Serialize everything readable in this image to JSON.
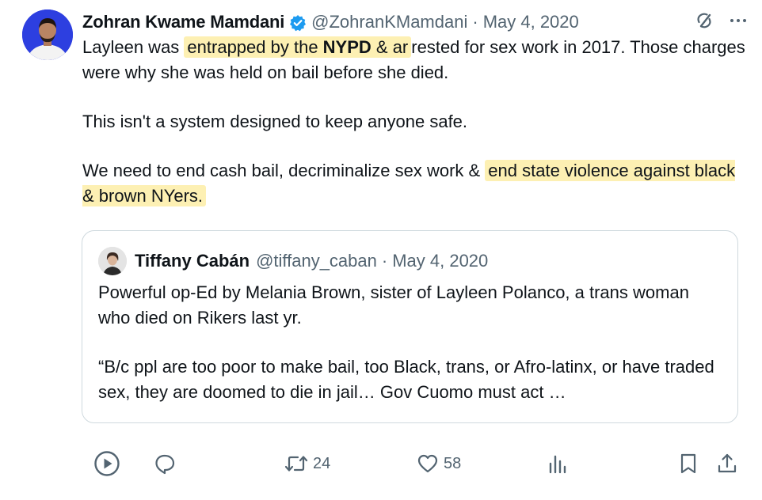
{
  "tweet": {
    "author_name": "Zohran Kwame Mamdani",
    "author_handle": "@ZohranKMamdani",
    "separator": "·",
    "date": "May 4, 2020",
    "p1_pre": "Layleen was ",
    "p1_hl_a": "entrapped by the ",
    "p1_hl_bold": "NYPD",
    "p1_hl_b": " & ar",
    "p1_post": "rested for sex work in 2017. Those charges were why she was held on bail before she died.",
    "p2": "This isn't a system designed to keep anyone safe.",
    "p3_pre": "We need to end cash bail, decriminalize sex work & ",
    "p3_hl": "end state violence against black & brown NYers."
  },
  "quote": {
    "author_name": "Tiffany Cabán",
    "author_handle": "@tiffany_caban",
    "separator": "·",
    "date": "May 4, 2020",
    "p1": "Powerful op-Ed by Melania Brown, sister of Layleen Polanco, a trans woman who died on Rikers last yr.",
    "p2": "“B/c ppl are too poor to make bail, too Black, trans, or Afro-latinx, or have traded sex, they are doomed to die in jail… Gov Cuomo must act …"
  },
  "actions": {
    "retweet_count": "24",
    "like_count": "58"
  },
  "icons": {
    "header": [
      "verified-icon",
      "grok-icon",
      "more-icon"
    ],
    "actions": [
      "play-icon",
      "reply-icon",
      "retweet-icon",
      "like-icon",
      "views-icon",
      "bookmark-icon",
      "share-icon"
    ]
  },
  "colors": {
    "highlight": "#fdf0b3",
    "verified": "#1d9bf0",
    "avatar_bg": "#2d3fe0",
    "muted": "#536471"
  }
}
